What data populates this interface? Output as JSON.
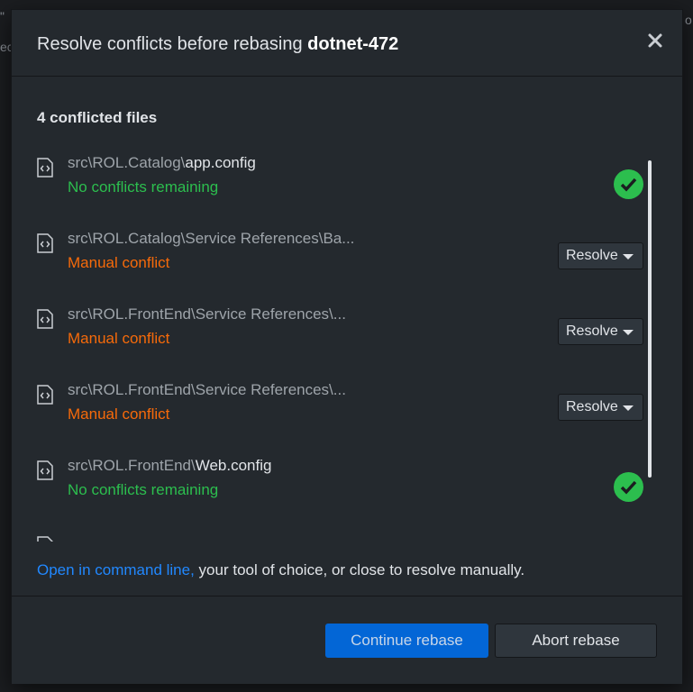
{
  "background": {
    "left_fragment_1": "\"",
    "left_fragment_2": "ec",
    "right_fragment": "o"
  },
  "dialog": {
    "title_prefix": "Resolve conflicts before rebasing ",
    "branch": "dotnet-472",
    "close_icon": "close-icon"
  },
  "conflicts": {
    "count_label": "4 conflicted files",
    "files": [
      {
        "dir": "src\\ROL.Catalog\\",
        "file": "app.config",
        "status": "No conflicts remaining",
        "state": "resolved"
      },
      {
        "dir": "src\\ROL.Catalog\\Service References\\Ba...",
        "file": "",
        "status": "Manual conflict",
        "state": "conflict",
        "action": "Resolve"
      },
      {
        "dir": "src\\ROL.FrontEnd\\Service References\\...",
        "file": "",
        "status": "Manual conflict",
        "state": "conflict",
        "action": "Resolve"
      },
      {
        "dir": "src\\ROL.FrontEnd\\Service References\\...",
        "file": "",
        "status": "Manual conflict",
        "state": "conflict",
        "action": "Resolve"
      },
      {
        "dir": "src\\ROL.FrontEnd\\",
        "file": "Web.config",
        "status": "No conflicts remaining",
        "state": "resolved"
      }
    ]
  },
  "note": {
    "link": "Open in command line,",
    "rest": " your tool of choice, or close to resolve manually."
  },
  "footer": {
    "continue_label": "Continue rebase",
    "abort_label": "Abort rebase"
  },
  "colors": {
    "resolved": "#2cbe4e",
    "conflict": "#f66a0a",
    "link": "#2188ff",
    "primary_button": "#0366d6"
  }
}
